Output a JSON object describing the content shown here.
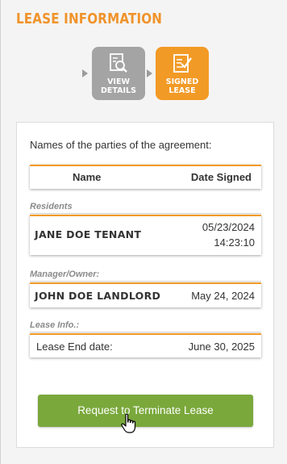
{
  "page": {
    "title": "LEASE INFORMATION"
  },
  "steps": [
    {
      "label_line1": "VIEW",
      "label_line2": "DETAILS",
      "icon": "magnifier-document-icon",
      "color": "#a4a4a4"
    },
    {
      "label_line1": "SIGNED",
      "label_line2": "LEASE",
      "icon": "signed-document-icon",
      "color": "#f29a26",
      "active": true
    }
  ],
  "card": {
    "intro": "Names of the parties of the agreement:",
    "columns": {
      "name": "Name",
      "date_signed": "Date Signed"
    },
    "residents": {
      "label": "Residents",
      "name": "JANE DOE TENANT",
      "date": "05/23/2024",
      "time": "14:23:10"
    },
    "manager": {
      "label": "Manager/Owner:",
      "name": "JOHN DOE LANDLORD",
      "date": "May 24, 2024"
    },
    "lease_info": {
      "label": "Lease Info.:",
      "field_label": "Lease End date:",
      "value": "June 30, 2025"
    },
    "terminate_button": "Request to Terminate Lease"
  },
  "colors": {
    "accent_orange": "#f29a26",
    "title_orange": "#f0932a",
    "button_green": "#7aa83b",
    "step_gray": "#a4a4a4"
  }
}
